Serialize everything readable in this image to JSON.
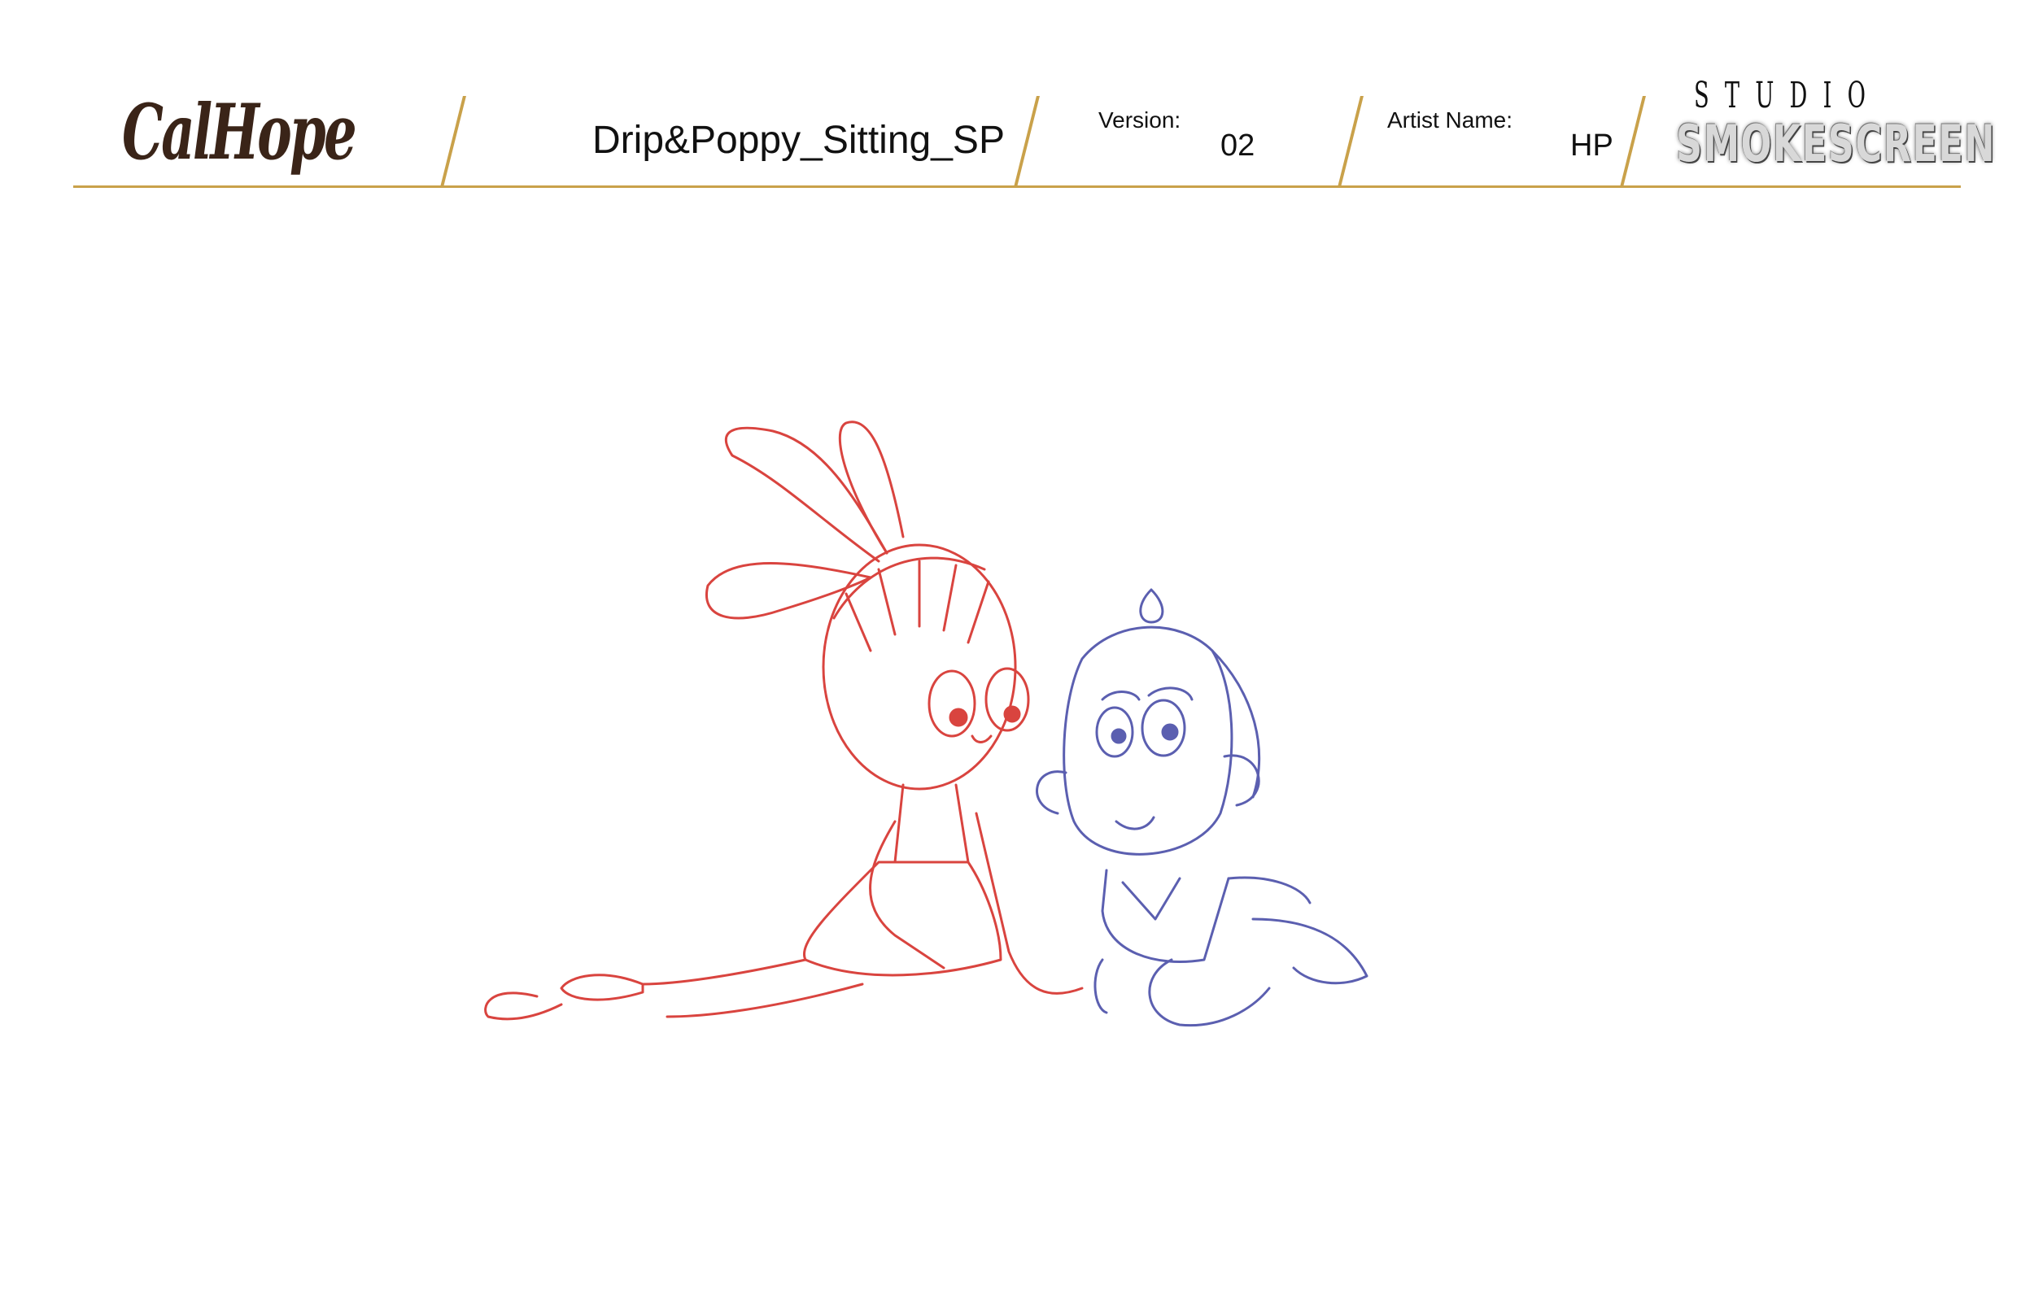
{
  "header": {
    "brand_logo": "CalHope",
    "scene_title": "Drip&Poppy_Sitting_SP",
    "version_label": "Version:",
    "version_value": "02",
    "artist_label": "Artist Name:",
    "artist_value": "HP",
    "studio_logo_top": "STUDIO",
    "studio_logo_bottom": "SMOKESCREEN"
  },
  "colors": {
    "accent_gold": "#c9a14a",
    "poppy_line": "#d9443f",
    "drip_line": "#5b5fb0"
  }
}
